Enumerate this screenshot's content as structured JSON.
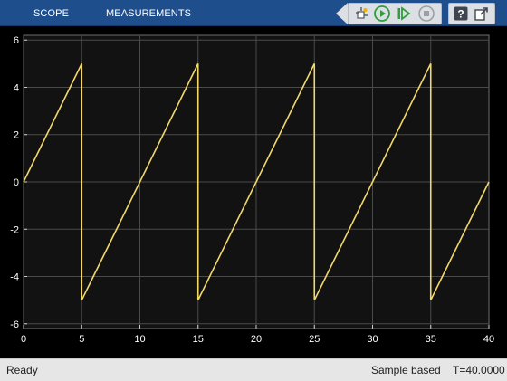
{
  "toolbar": {
    "tabs": [
      {
        "label": "SCOPE"
      },
      {
        "label": "MEASUREMENTS"
      }
    ],
    "buttons": [
      {
        "name": "highlight-simulink-block",
        "icon": "block-highlight-icon"
      },
      {
        "name": "run",
        "icon": "run-icon"
      },
      {
        "name": "step-forward",
        "icon": "step-forward-icon"
      },
      {
        "name": "stop",
        "icon": "stop-icon"
      },
      {
        "name": "help",
        "icon": "help-icon"
      },
      {
        "name": "undock",
        "icon": "undock-icon"
      }
    ],
    "colors": {
      "background": "#1f4e8c",
      "run_green": "#2f9e3e",
      "stop_disabled": "#9aa0a6"
    }
  },
  "plot": {
    "background": "#121212",
    "grid_color": "#4a4a4a",
    "trace_color": "#f2d86a",
    "tick_color": "#ffffff"
  },
  "chart_data": {
    "type": "line",
    "title": "",
    "xlabel": "",
    "ylabel": "",
    "xlim": [
      0,
      40
    ],
    "ylim": [
      -6.2,
      6.2
    ],
    "xticks": [
      0,
      5,
      10,
      15,
      20,
      25,
      30,
      35,
      40
    ],
    "yticks": [
      -6,
      -4,
      -2,
      0,
      2,
      4,
      6
    ],
    "grid": true,
    "legend": "none",
    "series": [
      {
        "color": "#f2d86a",
        "x": [
          0,
          5,
          5,
          15,
          15,
          25,
          25,
          35,
          35,
          40
        ],
        "y": [
          0,
          5,
          -5,
          5,
          -5,
          5,
          -5,
          5,
          -5,
          0
        ]
      }
    ]
  },
  "status": {
    "left": "Ready",
    "mode": "Sample based",
    "time": "T=40.0000"
  }
}
